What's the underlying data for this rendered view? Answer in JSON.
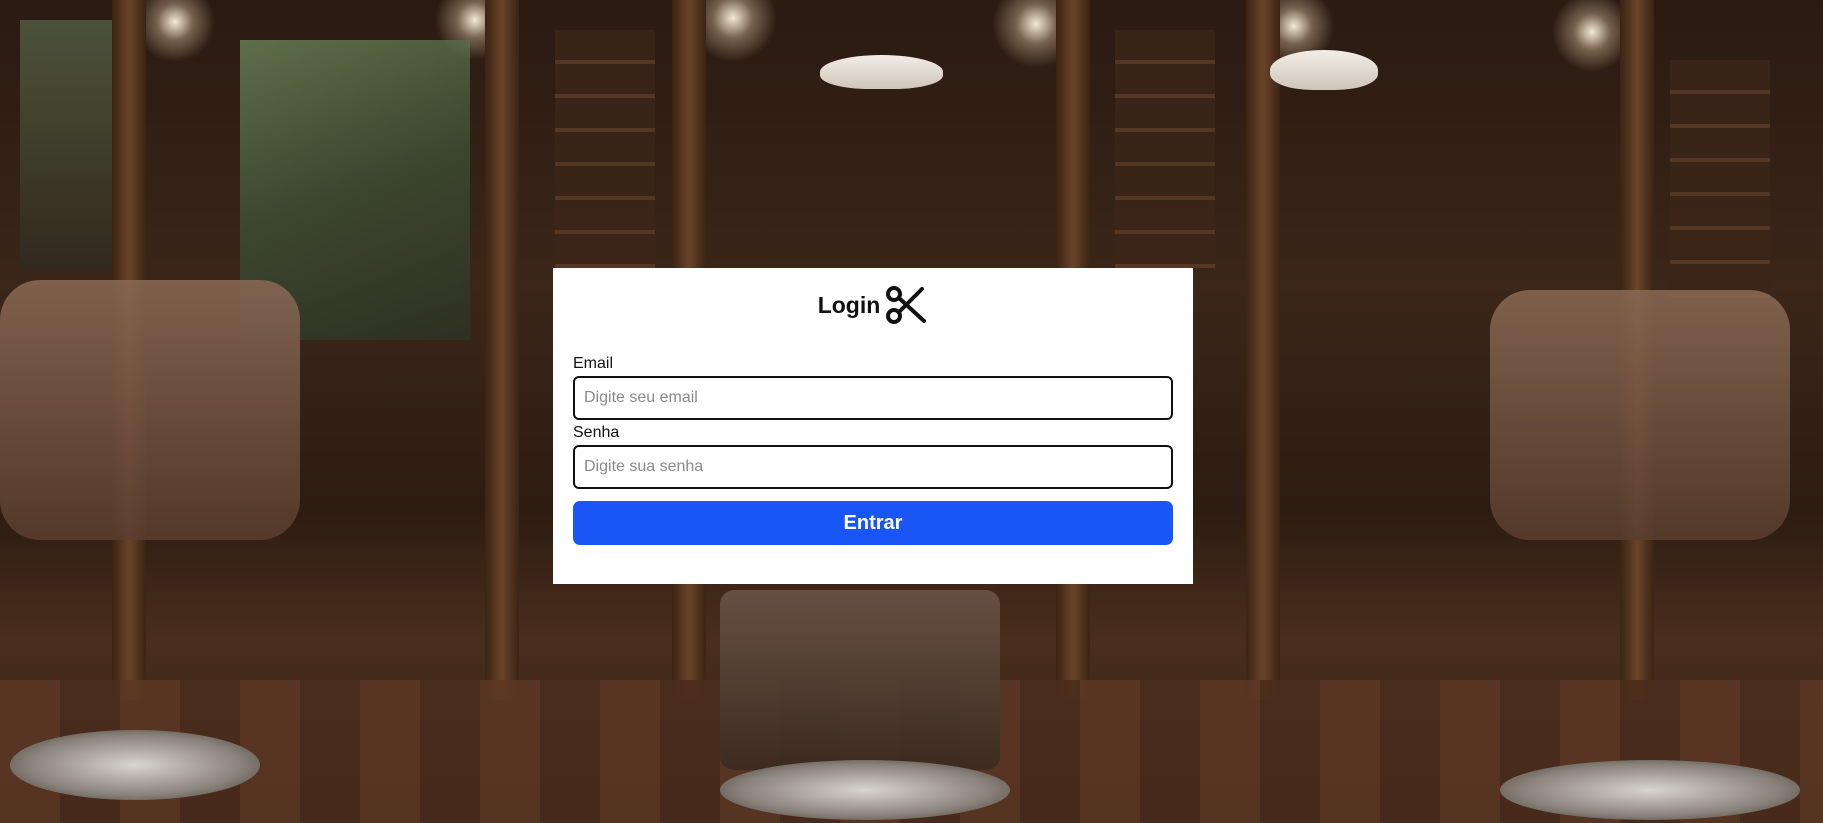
{
  "login": {
    "title": "Login",
    "title_icon": "scissors-icon",
    "email_label": "Email",
    "email_placeholder": "Digite seu email",
    "email_value": "",
    "password_label": "Senha",
    "password_placeholder": "Digite sua senha",
    "password_value": "",
    "submit_label": "Entrar"
  },
  "colors": {
    "accent": "#1a56f5",
    "card_background": "#ffffff",
    "input_border": "#111111"
  }
}
